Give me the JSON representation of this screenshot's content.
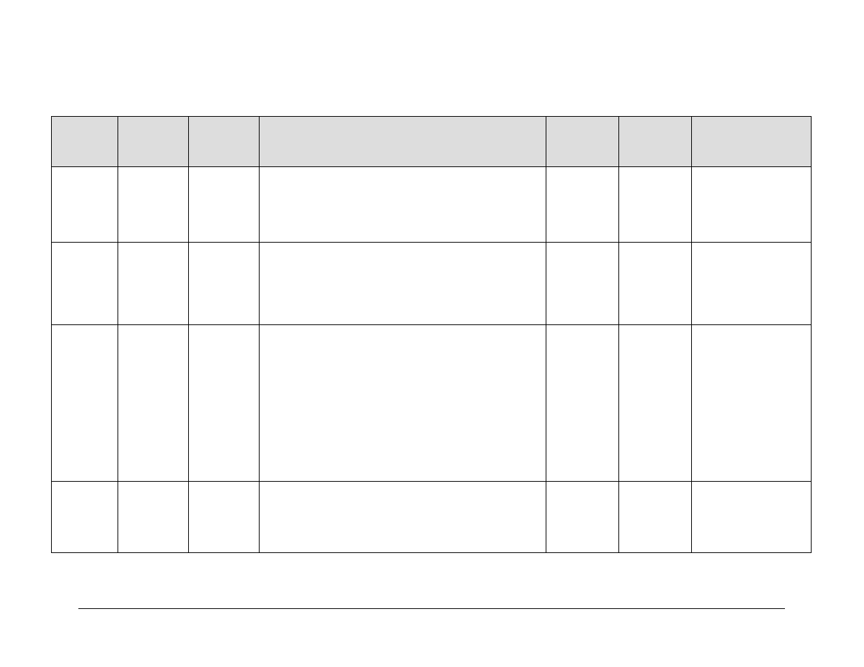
{
  "table": {
    "headers": [
      "",
      "",
      "",
      "",
      "",
      "",
      ""
    ],
    "rows": [
      [
        "",
        "",
        "",
        "",
        "",
        "",
        ""
      ],
      [
        "",
        "",
        "",
        "",
        "",
        "",
        ""
      ],
      [
        "",
        "",
        "",
        "",
        "",
        "",
        ""
      ],
      [
        "",
        "",
        "",
        "",
        "",
        "",
        ""
      ]
    ]
  }
}
